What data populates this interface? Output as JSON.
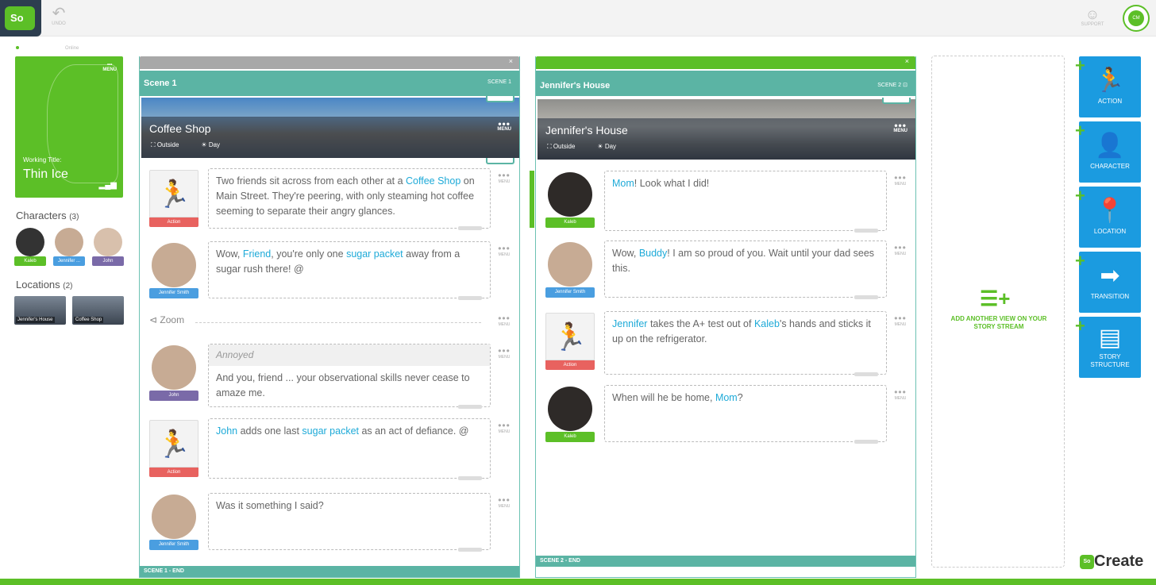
{
  "app": {
    "logo_text": "So",
    "undo_label": "UNDO",
    "support_label": "SUPPORT",
    "user_initials": "CM",
    "online_label": "Online",
    "brand": "Create",
    "brand_prefix": "So"
  },
  "title_card": {
    "menu": "MENU",
    "working_title_label": "Working Title:",
    "title": "Thin Ice"
  },
  "characters": {
    "heading": "Characters",
    "count": "(3)",
    "items": [
      {
        "name": "Kaleb",
        "color": "#5cbf27"
      },
      {
        "name": "Jennifer ...",
        "color": "#4a9ee0"
      },
      {
        "name": "John",
        "color": "#7a6aa8"
      }
    ]
  },
  "locations": {
    "heading": "Locations",
    "count": "(2)",
    "items": [
      "Jennifer's House",
      "Coffee Shop"
    ]
  },
  "scene1": {
    "title": "Scene 1",
    "number": "SCENE 1",
    "close": "×",
    "location": "Coffee Shop",
    "setting": "Outside",
    "time": "Day",
    "menu": "MENU",
    "end": "SCENE 1 - END",
    "beats": [
      {
        "who": "Action",
        "segments": [
          [
            "Two friends sit across from each other at a ",
            0
          ],
          [
            "Coffee Shop",
            1
          ],
          [
            " on Main Street. They're peering, with only steaming hot coffee seeming to separate their angry glances.",
            0
          ]
        ]
      },
      {
        "who": "Jennifer Smith",
        "segments": [
          [
            "Wow, ",
            0
          ],
          [
            "Friend",
            1
          ],
          [
            ", you're only one ",
            0
          ],
          [
            "sugar packet",
            1
          ],
          [
            " away from a sugar rush there! @",
            0
          ]
        ]
      },
      {
        "zoom": "Zoom"
      },
      {
        "who": "John",
        "parenthetical": "Annoyed",
        "segments": [
          [
            "And you, friend ... your observational skills never cease to amaze me.",
            0
          ]
        ]
      },
      {
        "who": "Action",
        "segments": [
          [
            "John",
            1
          ],
          [
            " adds one last ",
            0
          ],
          [
            "sugar packet",
            1
          ],
          [
            " as an act of defiance. @",
            0
          ]
        ]
      },
      {
        "who": "Jennifer Smith",
        "segments": [
          [
            "Was it something I said?",
            0
          ]
        ]
      }
    ]
  },
  "scene2": {
    "title": "Jennifer's House",
    "number": "SCENE 2",
    "close": "×",
    "location": "Jennifer's House",
    "setting": "Outside",
    "time": "Day",
    "menu": "MENU",
    "end": "SCENE 2 - END",
    "beats": [
      {
        "who": "Kaleb",
        "segments": [
          [
            "Mom",
            1
          ],
          [
            "! Look what I did!",
            0
          ]
        ]
      },
      {
        "who": "Jennifer Smith",
        "segments": [
          [
            "Wow, ",
            0
          ],
          [
            "Buddy",
            1
          ],
          [
            "! I am so proud of you. Wait until your dad sees this.",
            0
          ]
        ]
      },
      {
        "who": "Action",
        "segments": [
          [
            "Jennifer",
            1
          ],
          [
            " takes the A+ test out of ",
            0
          ],
          [
            "Kaleb",
            1
          ],
          [
            "'s hands and sticks it up on the refrigerator.",
            0
          ]
        ]
      },
      {
        "who": "Kaleb",
        "segments": [
          [
            "When will he be home, ",
            0
          ],
          [
            "Mom",
            1
          ],
          [
            "?",
            0
          ]
        ]
      }
    ]
  },
  "beat_menu": "MENU",
  "add_view": "ADD ANOTHER VIEW ON YOUR STORY STREAM",
  "tools": [
    "ACTION",
    "CHARACTER",
    "LOCATION",
    "TRANSITION",
    "STORY STRUCTURE"
  ],
  "colors": {
    "green": "#5cbf27",
    "teal": "#5bb4a4",
    "blue": "#1b9be0",
    "action_red": "#e8625f",
    "link": "#1eaad8"
  }
}
